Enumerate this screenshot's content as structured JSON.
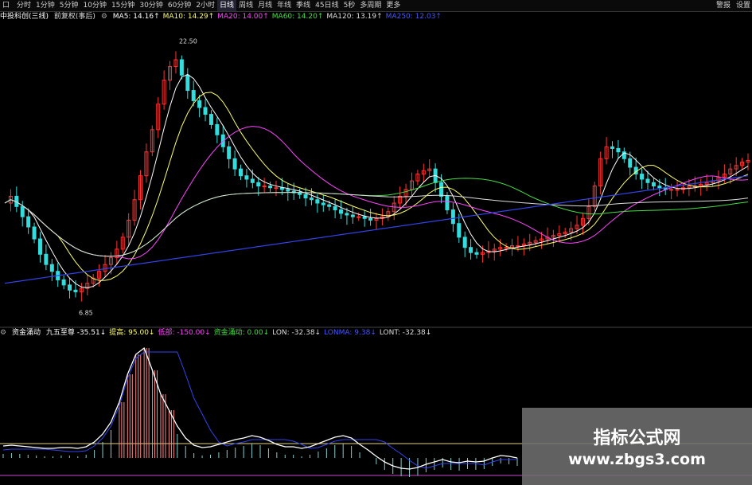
{
  "toolbar": {
    "items": [
      "分时",
      "1分钟",
      "5分钟",
      "10分钟",
      "15分钟",
      "30分钟",
      "60分钟",
      "2小时",
      "日线",
      "周线",
      "月线",
      "年线",
      "季线",
      "45日线",
      "5秒",
      "多周期",
      "更多"
    ],
    "active_index": 8,
    "right_items": [
      "警报",
      "设置"
    ]
  },
  "top_legend": {
    "title": "中投科创(三线)",
    "subtitle": "前复权(事后)",
    "items": [
      {
        "label": "MA5:",
        "value": "14.16",
        "color": "#ffffff"
      },
      {
        "label": "MA10:",
        "value": "14.29",
        "color": "#ffff66"
      },
      {
        "label": "MA20:",
        "value": "14.00",
        "color": "#ff44ff"
      },
      {
        "label": "MA60:",
        "value": "14.20",
        "color": "#44dd44"
      },
      {
        "label": "MA120:",
        "value": "13.19",
        "color": "#dddddd"
      },
      {
        "label": "MA250:",
        "value": "12.03",
        "color": "#4455ff"
      }
    ]
  },
  "sub_legend": {
    "title": "资金涌动",
    "items": [
      {
        "label": "九五至尊",
        "value": "-35.51",
        "color": "#ffffff"
      },
      {
        "label": "提高:",
        "value": "95.00",
        "color": "#ffff66"
      },
      {
        "label": "低部:",
        "value": "-150.00",
        "color": "#ff44ff"
      },
      {
        "label": "资金涌动:",
        "value": "0.00",
        "color": "#44dd44"
      },
      {
        "label": "LON:",
        "value": "-32.38",
        "color": "#dddddd"
      },
      {
        "label": "LONMA:",
        "value": "9.38",
        "color": "#4455ff"
      },
      {
        "label": "LONT:",
        "value": "-32.38",
        "color": "#dddddd"
      }
    ]
  },
  "chart_data": [
    {
      "type": "candlestick",
      "title": "",
      "annotations": [
        {
          "text": "22.50"
        },
        {
          "text": "6.85"
        }
      ],
      "close_path": [
        13.0,
        13.4,
        12.8,
        12.2,
        11.6,
        10.9,
        10.0,
        9.4,
        9.0,
        8.5,
        8.2,
        7.9,
        7.8,
        8.0,
        8.3,
        8.6,
        9.0,
        9.4,
        9.8,
        10.3,
        11.0,
        12.0,
        13.2,
        14.6,
        16.0,
        17.3,
        18.8,
        20.2,
        21.0,
        21.4,
        20.5,
        19.6,
        19.0,
        18.6,
        18.2,
        17.6,
        17.0,
        16.3,
        15.6,
        15.0,
        14.6,
        14.4,
        14.2,
        14.0,
        14.0,
        13.9,
        13.9,
        13.8,
        13.7,
        13.6,
        13.5,
        13.3,
        13.2,
        13.0,
        12.9,
        12.8,
        12.6,
        12.4,
        12.3,
        12.2,
        12.2,
        12.1,
        12.0,
        12.1,
        12.2,
        12.5,
        13.0,
        13.4,
        13.8,
        14.3,
        14.7,
        14.9,
        15.0,
        14.2,
        13.4,
        12.6,
        11.8,
        11.0,
        10.4,
        10.1,
        10.0,
        10.1,
        10.2,
        10.3,
        10.4,
        10.4,
        10.5,
        10.5,
        10.6,
        10.7,
        10.8,
        10.9,
        11.0,
        11.1,
        11.2,
        11.3,
        11.5,
        11.7,
        12.1,
        12.8,
        14.0,
        15.6,
        16.3,
        16.2,
        16.0,
        15.6,
        15.1,
        14.7,
        14.4,
        14.2,
        14.0,
        13.9,
        13.8,
        13.8,
        13.8,
        13.9,
        14.0,
        14.0,
        14.1,
        14.2,
        14.3,
        14.5,
        14.7,
        15.0,
        15.2,
        15.4,
        15.5
      ]
    },
    {
      "type": "line",
      "title": "",
      "series": [
        {
          "name": "九五至尊",
          "values": [
            -35,
            -34,
            -35,
            -36,
            -37,
            -38,
            -38,
            -37,
            -37,
            -38,
            -36,
            -30,
            -20,
            -5,
            20,
            55,
            80,
            88,
            60,
            30,
            10,
            -10,
            -25,
            -34,
            -37,
            -36,
            -33,
            -30,
            -27,
            -25,
            -22,
            -24,
            -28,
            -33,
            -36,
            -36,
            -38,
            -36,
            -32,
            -28,
            -24,
            -22,
            -25,
            -33,
            -40,
            -48,
            -55,
            -60,
            -63,
            -64,
            -62,
            -58,
            -55,
            -52,
            -55,
            -56,
            -54,
            -55,
            -54,
            -50,
            -47,
            -48,
            -50
          ]
        },
        {
          "name": "提高",
          "values": [
            95
          ]
        },
        {
          "name": "低部",
          "values": [
            -150
          ]
        }
      ]
    }
  ],
  "watermark": {
    "line1": "指标公式网",
    "line2": "www.zbgs3.com"
  }
}
